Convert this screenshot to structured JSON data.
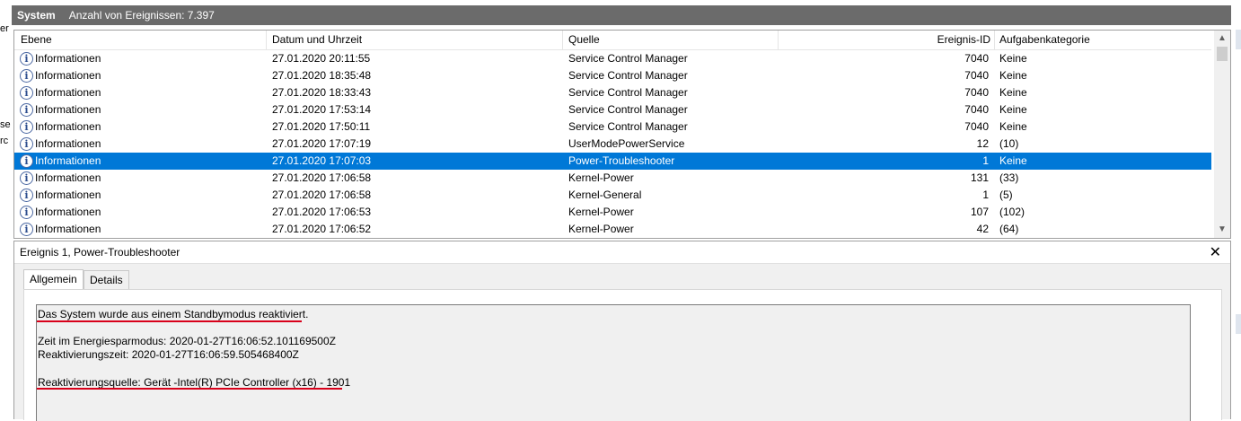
{
  "window": {
    "log_name": "System",
    "event_count_label": "Anzahl von Ereignissen: 7.397"
  },
  "columns": {
    "level": "Ebene",
    "datetime": "Datum und Uhrzeit",
    "source": "Quelle",
    "event_id": "Ereignis-ID",
    "category": "Aufgabenkategorie"
  },
  "events": [
    {
      "level": "Informationen",
      "datetime": "27.01.2020 20:11:55",
      "source": "Service Control Manager",
      "event_id": "7040",
      "category": "Keine"
    },
    {
      "level": "Informationen",
      "datetime": "27.01.2020 18:35:48",
      "source": "Service Control Manager",
      "event_id": "7040",
      "category": "Keine"
    },
    {
      "level": "Informationen",
      "datetime": "27.01.2020 18:33:43",
      "source": "Service Control Manager",
      "event_id": "7040",
      "category": "Keine"
    },
    {
      "level": "Informationen",
      "datetime": "27.01.2020 17:53:14",
      "source": "Service Control Manager",
      "event_id": "7040",
      "category": "Keine"
    },
    {
      "level": "Informationen",
      "datetime": "27.01.2020 17:50:11",
      "source": "Service Control Manager",
      "event_id": "7040",
      "category": "Keine"
    },
    {
      "level": "Informationen",
      "datetime": "27.01.2020 17:07:19",
      "source": "UserModePowerService",
      "event_id": "12",
      "category": "(10)"
    },
    {
      "level": "Informationen",
      "datetime": "27.01.2020 17:07:03",
      "source": "Power-Troubleshooter",
      "event_id": "1",
      "category": "Keine",
      "selected": true
    },
    {
      "level": "Informationen",
      "datetime": "27.01.2020 17:06:58",
      "source": "Kernel-Power",
      "event_id": "131",
      "category": "(33)"
    },
    {
      "level": "Informationen",
      "datetime": "27.01.2020 17:06:58",
      "source": "Kernel-General",
      "event_id": "1",
      "category": "(5)"
    },
    {
      "level": "Informationen",
      "datetime": "27.01.2020 17:06:53",
      "source": "Kernel-Power",
      "event_id": "107",
      "category": "(102)"
    },
    {
      "level": "Informationen",
      "datetime": "27.01.2020 17:06:52",
      "source": "Kernel-Power",
      "event_id": "42",
      "category": "(64)"
    }
  ],
  "info_icon": "info-icon",
  "detail": {
    "title": "Ereignis 1, Power-Troubleshooter",
    "close_glyph": "✕",
    "tabs": [
      "Allgemein",
      "Details"
    ],
    "active_tab": "Allgemein",
    "description": {
      "headline": "Das System wurde aus einem Standbymodus reaktiviert.",
      "sleep_time": "Zeit im Energiesparmodus: 2020-01-27T16:06:52.101169500Z",
      "wake_time": "Reaktivierungszeit: 2020-01-27T16:06:59.505468400Z",
      "wake_source": "Reaktivierungsquelle: Gerät -Intel(R) PCIe Controller (x16) - 1901"
    }
  },
  "left_edge_fragments": [
    "er",
    "se",
    "rc"
  ],
  "colors": {
    "selection": "#0078d7",
    "title_bar": "#6b6b6b",
    "annotation": "#d8001a"
  }
}
